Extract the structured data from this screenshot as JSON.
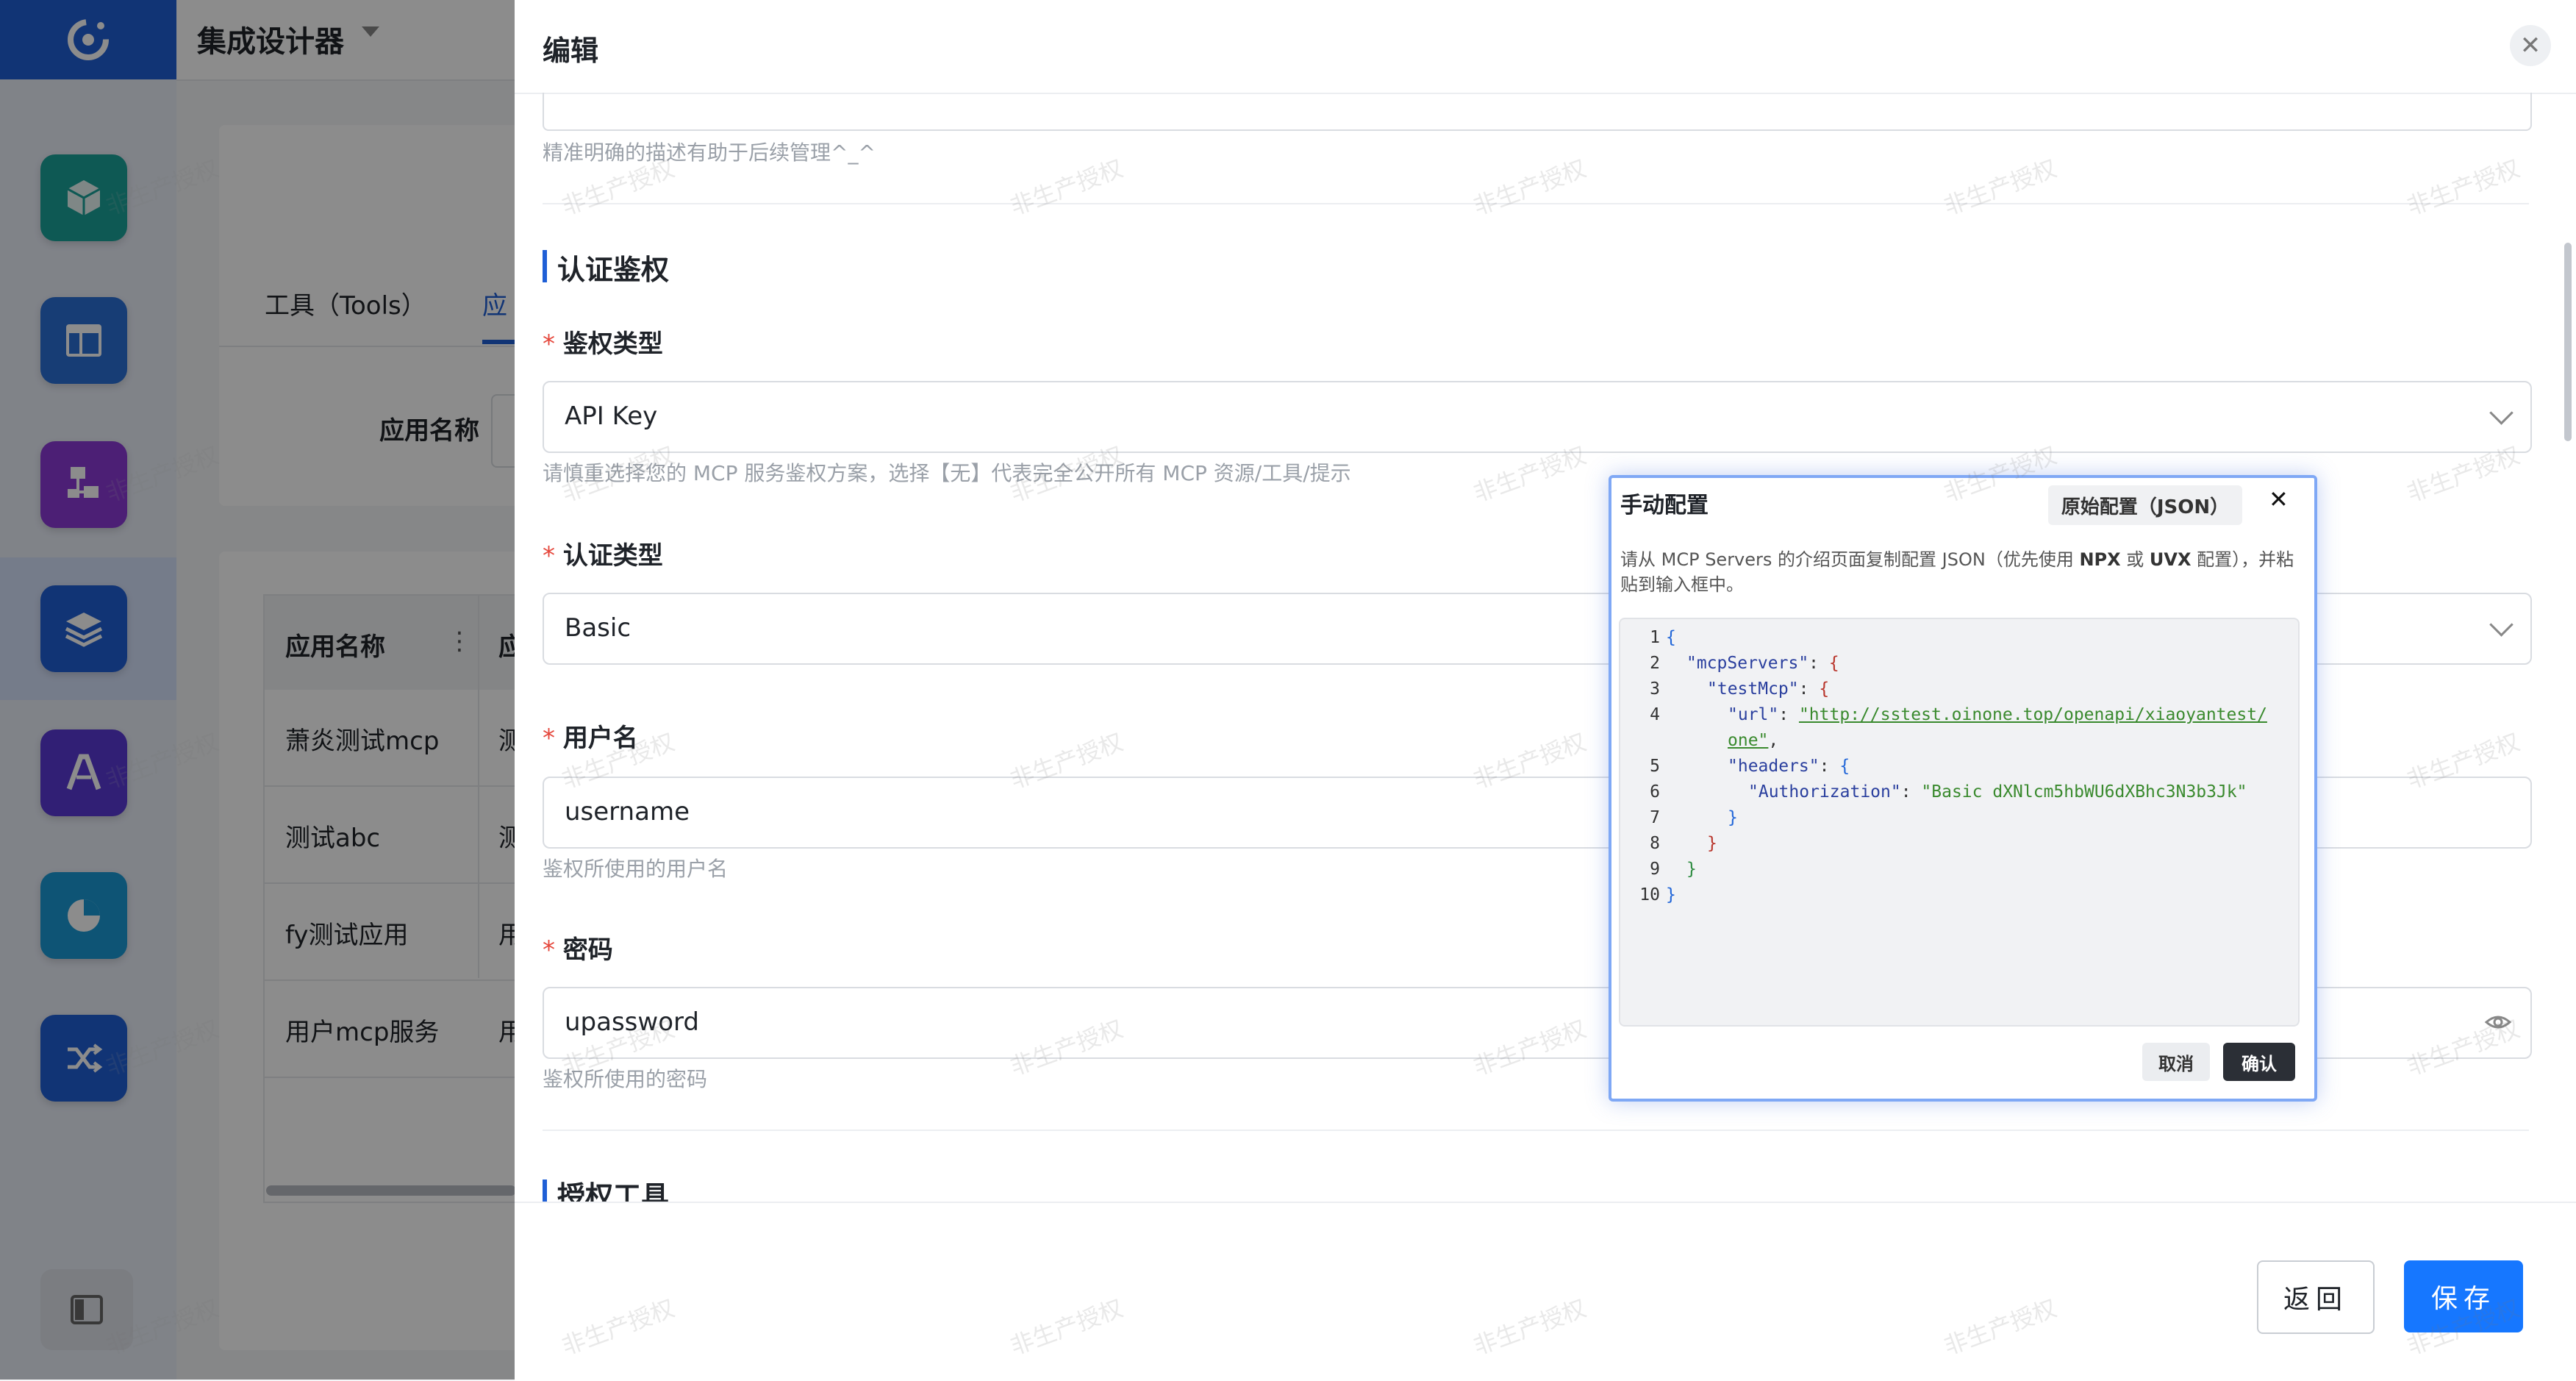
{
  "app": {
    "title": "集成设计器"
  },
  "rail": {
    "items": [
      {
        "icon": "cube-icon",
        "color": "#1aa39a"
      },
      {
        "icon": "layout-icon",
        "color": "#2a6fd6"
      },
      {
        "icon": "org-chart-icon",
        "color": "#8a3ad6"
      },
      {
        "icon": "layers-icon",
        "color": "#1f5fd6"
      },
      {
        "icon": "letter-a-icon",
        "color": "#5a3ad6"
      },
      {
        "icon": "pie-chart-icon",
        "color": "#1a9ad6"
      },
      {
        "icon": "shuffle-icon",
        "color": "#1f5fd6"
      }
    ]
  },
  "background": {
    "tabs": [
      "工具（Tools）",
      "应"
    ],
    "filter_label": "应用名称",
    "table": {
      "header": [
        "应用名称",
        "应"
      ],
      "rows": [
        [
          "萧炎测试mcp",
          "测"
        ],
        [
          "测试abc",
          "测"
        ],
        [
          "fy测试应用",
          "用"
        ],
        [
          "用户mcp服务",
          "用"
        ]
      ]
    }
  },
  "drawer": {
    "title": "编辑",
    "desc_help": "精准明确的描述有助于后续管理^_^",
    "section_auth": "认证鉴权",
    "auth_type": {
      "label": "鉴权类型",
      "value": "API Key",
      "help": "请慎重选择您的 MCP 服务鉴权方案，选择【无】代表完全公开所有 MCP 资源/工具/提示"
    },
    "cred_type": {
      "label": "认证类型",
      "value": "Basic"
    },
    "username": {
      "label": "用户名",
      "value": "username",
      "help": "鉴权所使用的用户名"
    },
    "password": {
      "label": "密码",
      "value": "upassword",
      "help": "鉴权所使用的密码"
    },
    "section_tools": "授权工具",
    "back_label": "返回",
    "save_label": "保存"
  },
  "popup": {
    "title": "手动配置",
    "raw_label": "原始配置（JSON）",
    "desc_prefix": "请从 MCP Servers 的介绍页面复制配置 JSON（优先使用 ",
    "desc_npx": "NPX",
    "desc_mid": " 或 ",
    "desc_uvx": "UVX",
    "desc_suffix": " 配置），并粘贴到输入框中。",
    "code": {
      "key_servers": "\"mcpServers\"",
      "key_test": "\"testMcp\"",
      "key_url": "\"url\"",
      "url_part1": "\"http://sstest.oinone.top/openapi/xiaoyantest/",
      "url_part2": "one\"",
      "key_headers": "\"headers\"",
      "key_auth": "\"Authorization\"",
      "auth_value": "\"Basic dXNlcm5hbWU6dXBhc3N3b3Jk\""
    },
    "cancel_label": "取消",
    "ok_label": "确认"
  },
  "watermark": "非生产授权"
}
